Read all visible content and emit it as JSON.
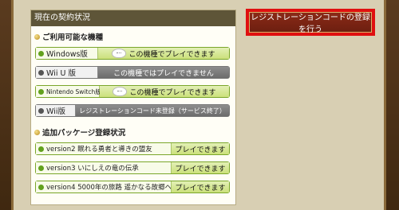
{
  "contract": {
    "header": "現在の契約状況",
    "available_devices_title": "ご利用可能な機種",
    "devices": [
      {
        "name": "Windows版",
        "status": "この機種でプレイできます",
        "state": "ok"
      },
      {
        "name": "Wii U 版",
        "status": "この機種ではプレイできません",
        "state": "ng"
      },
      {
        "name": "Nintendo Switch版",
        "status": "この機種でプレイできます",
        "state": "ok"
      },
      {
        "name": "Wii版",
        "status": "レジストレーションコード未登録（サービス終了）",
        "state": "ng"
      }
    ],
    "packages_title": "追加パッケージ登録状況",
    "packages": [
      {
        "name": "version2  眠れる勇者と導きの盟友",
        "status": "プレイできます"
      },
      {
        "name": "version3  いにしえの竜の伝承",
        "status": "プレイできます"
      },
      {
        "name": "version4  5000年の旅路 遥かなる故郷へ",
        "status": "プレイできます"
      }
    ]
  },
  "register_button_label": "レジストレーションコードの登録を行う",
  "colors": {
    "ok": "#62a11d",
    "ng": "#555555",
    "highlight": "#e01010",
    "header_bg": "#5e5538"
  }
}
